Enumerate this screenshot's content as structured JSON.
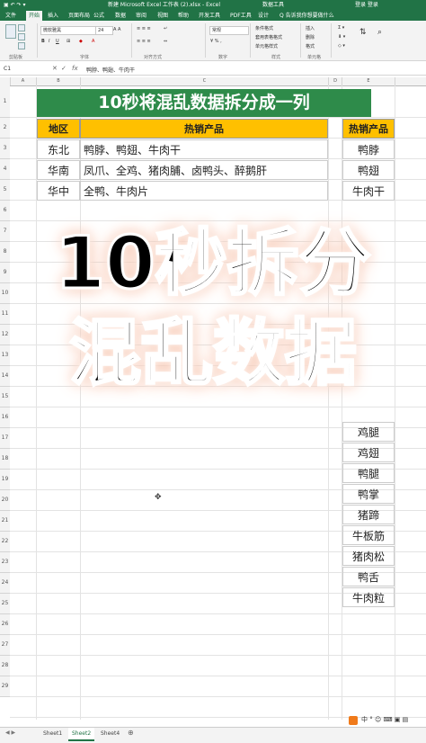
{
  "window": {
    "title": "新建 Microsoft Excel 工作表 (2).xlsx - Excel",
    "context_tab": "数据工具",
    "user": "登录 登录"
  },
  "ribbon_tabs": [
    "文件",
    "开始",
    "插入",
    "页面布局",
    "公式",
    "数据",
    "审阅",
    "视图",
    "帮助",
    "开发工具",
    "PDF工具",
    "设计",
    "Q 告诉我你想要做什么"
  ],
  "ribbon": {
    "font_name": "微软雅黑",
    "font_size": "24",
    "number_format": "常规",
    "groups": [
      "剪贴板",
      "字体",
      "对齐方式",
      "数字",
      "样式",
      "单元格"
    ],
    "style_items": [
      "条件格式",
      "套用表格格式",
      "单元格样式"
    ],
    "cell_items": [
      "插入",
      "删除",
      "格式"
    ]
  },
  "formula_bar": {
    "name_box": "C1",
    "content": "鸭脖、鸭翅、牛肉干"
  },
  "columns": [
    "A",
    "B",
    "C",
    "D",
    "E"
  ],
  "rows": [
    "1",
    "2",
    "3",
    "4",
    "5",
    "6",
    "7",
    "8",
    "9",
    "10",
    "11",
    "12",
    "13",
    "14",
    "15",
    "16",
    "17",
    "18",
    "19",
    "20",
    "21",
    "22",
    "23",
    "24",
    "25",
    "26",
    "27",
    "28",
    "29"
  ],
  "table": {
    "title": "10秒将混乱数据拆分成一列",
    "header_region": "地区",
    "header_product": "热销产品",
    "rows": [
      {
        "region": "东北",
        "products": "鸭脖、鸭翅、牛肉干"
      },
      {
        "region": "华南",
        "products": "凤爪、全鸡、猪肉脯、卤鸭头、醉鹅肝"
      },
      {
        "region": "华中",
        "products": "全鸭、牛肉片"
      }
    ]
  },
  "result": {
    "header": "热销产品",
    "top_items": [
      "鸭脖",
      "鸭翅",
      "牛肉干"
    ],
    "bottom_items": [
      "鸡腿",
      "鸡翅",
      "鸭腿",
      "鸭掌",
      "猪蹄",
      "牛板筋",
      "猪肉松",
      "鸭舌",
      "牛肉粒"
    ]
  },
  "overlay": {
    "line1": "10秒拆分",
    "line2": "混乱数据"
  },
  "sheet_tabs": [
    "Sheet1",
    "Sheet2",
    "Sheet4"
  ],
  "active_sheet": "Sheet2",
  "colors": {
    "excel_green": "#217346",
    "title_fill": "#2e8b4a",
    "header_fill": "#ffc000",
    "overlay_glow": "#f8c9b4"
  }
}
